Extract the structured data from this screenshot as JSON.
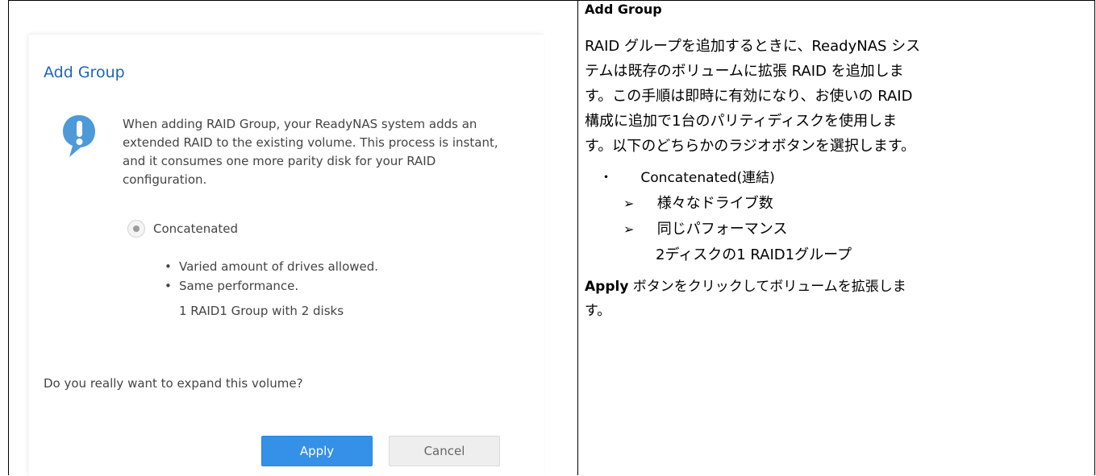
{
  "dialog": {
    "title": "Add Group",
    "message": "When adding RAID Group, your ReadyNAS system adds an extended RAID to the existing volume. This process is instant, and it consumes one more parity disk for your RAID configuration.",
    "option_label": "Concatenated",
    "bullets": [
      "Varied amount of drives allowed.",
      "Same performance."
    ],
    "raid_note": "1 RAID1 Group with 2 disks",
    "question": "Do you really want to expand this volume?",
    "apply_label": "Apply",
    "cancel_label": "Cancel",
    "colors": {
      "title": "#1e66b5",
      "apply": "#3590e8",
      "icon": "#4d9ad9"
    },
    "icon": "info-speech-bubble-icon"
  },
  "description": {
    "title": "Add Group",
    "lines": [
      "RAID グループを追加するときに、ReadyNAS シス",
      "テムは既存のボリュームに拡張 RAID を追加しま",
      "す。この手順は即時に有効になり、お使いの RAID",
      "構成に追加で1台のパリティディスクを使用しま",
      "す。以下のどちらかのラジオボタンを選択します。"
    ],
    "bullet_mark": "・",
    "bullet": "Concatenated(連結)",
    "sub_mark": "➢",
    "sub1": "様々なドライブ数",
    "sub2": "同じパフォーマンス",
    "sub3": "2ディスクの1 RAID1グループ",
    "apply_word": "Apply",
    "apply_rest_1": " ボタンをクリックしてボリュームを拡張しま",
    "apply_rest_2": "す。"
  }
}
